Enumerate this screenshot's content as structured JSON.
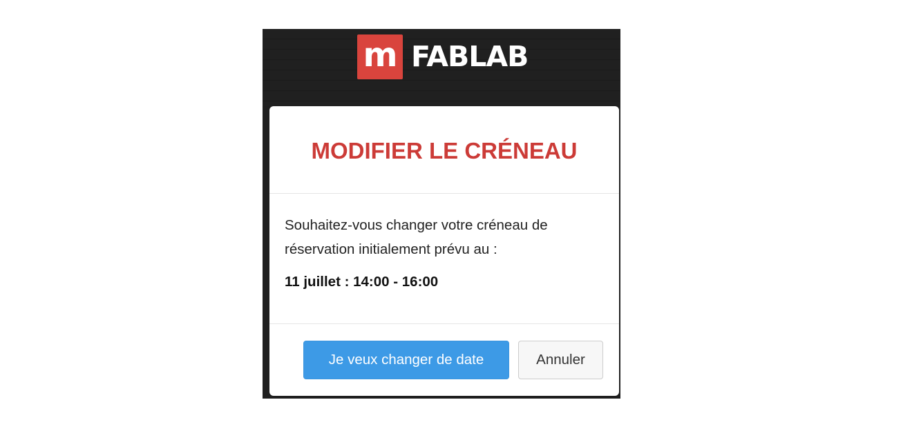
{
  "brand": {
    "mark": "m",
    "name": "FABLAB"
  },
  "modal": {
    "title": "MODIFIER LE CRÉNEAU",
    "body_line1": "Souhaitez-vous changer votre créneau de",
    "body_line2": "réservation initialement prévu au :",
    "slot": "11 juillet : 14:00 - 16:00",
    "confirm_label": "Je veux changer de date",
    "cancel_label": "Annuler"
  },
  "colors": {
    "brand_red": "#d9443d",
    "title_red": "#cc3b37",
    "primary_blue": "#3d9ae6",
    "topbar_dark": "#1f1f1f"
  }
}
